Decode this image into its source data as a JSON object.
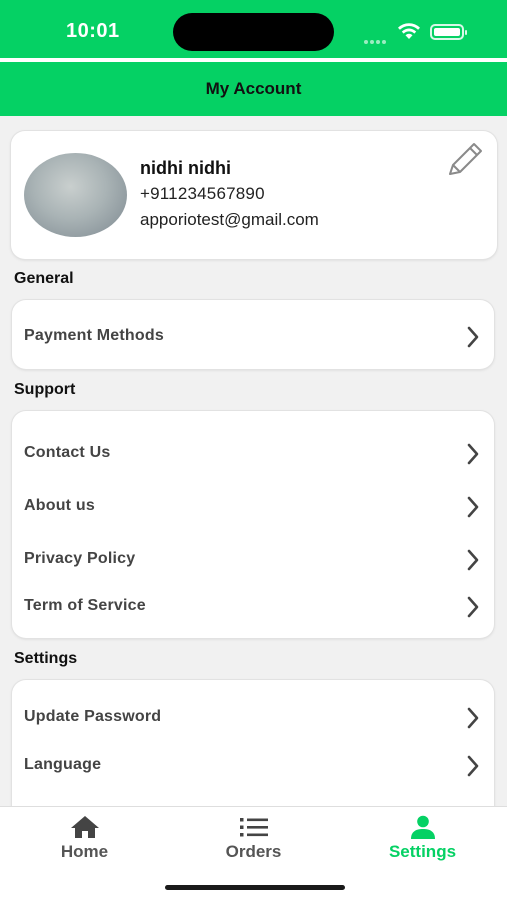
{
  "status_bar": {
    "time": "10:01"
  },
  "header": {
    "title": "My Account"
  },
  "profile": {
    "name": "nidhi nidhi",
    "phone": "+911234567890",
    "email": "apporiotest@gmail.com"
  },
  "sections": {
    "general": {
      "title": "General",
      "items": [
        {
          "label": "Payment Methods"
        }
      ]
    },
    "support": {
      "title": "Support",
      "items": [
        {
          "label": "Contact Us"
        },
        {
          "label": "About us"
        },
        {
          "label": "Privacy Policy"
        },
        {
          "label": "Term of Service"
        }
      ]
    },
    "settings": {
      "title": "Settings",
      "items": [
        {
          "label": "Update Password"
        },
        {
          "label": "Language"
        }
      ]
    }
  },
  "tabs": [
    {
      "label": "Home",
      "icon": "home-icon"
    },
    {
      "label": "Orders",
      "icon": "list-icon"
    },
    {
      "label": "Settings",
      "icon": "person-icon",
      "active": true
    }
  ],
  "colors": {
    "accent": "#05d164",
    "background": "#f1f1f1"
  }
}
